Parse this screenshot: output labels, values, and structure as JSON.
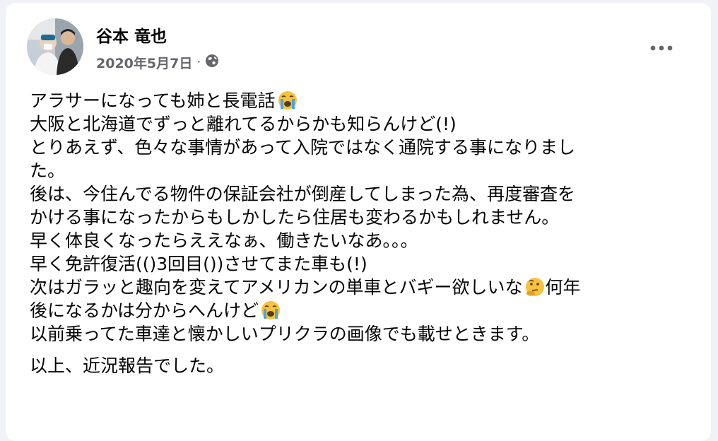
{
  "post": {
    "author": "谷本 竜也",
    "date": "2020年5月7日",
    "separator": "·",
    "audience_icon": "globe-icon",
    "menu_icon": "more-options-icon",
    "lines": [
      "アラサーになっても姉と長電話",
      "大阪と北海道でずっと離れてるからかも知らんけど(!)",
      "とりあえず、色々な事情があって入院ではなく通院する事になりまし",
      "た。",
      "後は、今住んでる物件の保証会社が倒産してしまった為、再度審査を",
      "かける事になったからもしかしたら住居も変わるかもしれません。",
      "早く体良くなったらええなぁ、働きたいなあ。。。",
      "早く免許復活(()3回目())させてまた車も(!)",
      "次はガラッと趣向を変えてアメリカンの単車とバギー欲しいな",
      "何年",
      "後になるかは分からへんけど",
      "以前乗ってた車達と懐かしいプリクラの画像でも載せときます。"
    ],
    "closing": "以上、近況報告でした。",
    "emojis": [
      "crying-face",
      "thinking-face-emoji",
      "crying-face"
    ]
  },
  "colors": {
    "background": "#f0f2f5",
    "card": "#ffffff",
    "text": "#050505",
    "secondary_text": "#65676b",
    "emoji_yellow": "#f7c23c"
  }
}
